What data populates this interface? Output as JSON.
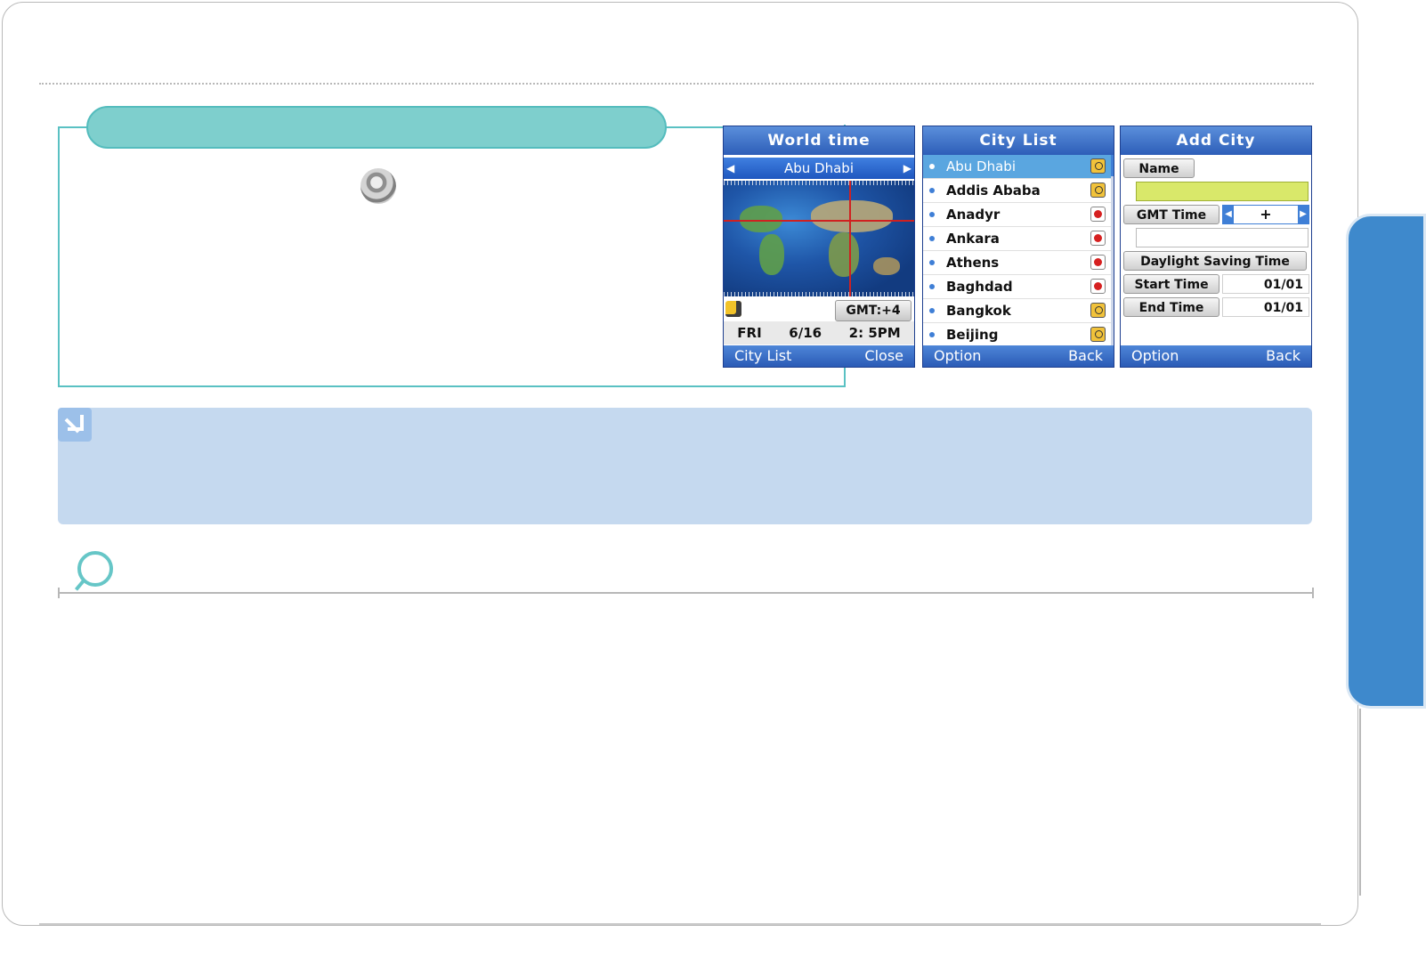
{
  "world_time": {
    "title": "World time",
    "city": "Abu Dhabi",
    "gmt": "GMT:+4",
    "day": "FRI",
    "date": "6/16",
    "time": "2: 5PM",
    "left_softkey": "City List",
    "right_softkey": "Close"
  },
  "city_list": {
    "title": "City List",
    "items": [
      {
        "name": "Abu Dhabi",
        "status_icon": "clock-icon"
      },
      {
        "name": "Addis Ababa",
        "status_icon": "clock-icon"
      },
      {
        "name": "Anadyr",
        "status_icon": "alarm-icon"
      },
      {
        "name": "Ankara",
        "status_icon": "alarm-icon"
      },
      {
        "name": "Athens",
        "status_icon": "alarm-icon"
      },
      {
        "name": "Baghdad",
        "status_icon": "alarm-icon"
      },
      {
        "name": "Bangkok",
        "status_icon": "clock-icon"
      },
      {
        "name": "Beijing",
        "status_icon": "clock-icon"
      }
    ],
    "left_softkey": "Option",
    "right_softkey": "Back"
  },
  "add_city": {
    "title": "Add City",
    "name_label": "Name",
    "name_value": "",
    "gmt_label": "GMT Time",
    "gmt_sign": "+",
    "gmt_value": "",
    "dst_label": "Daylight Saving Time",
    "start_label": "Start Time",
    "start_value": "01/01",
    "end_label": "End Time",
    "end_value": "01/01",
    "left_softkey": "Option",
    "right_softkey": "Back"
  },
  "colors": {
    "accent_teal": "#7ecfcd",
    "note_blue": "#c5d9ef",
    "side_tab": "#3e89cc",
    "screen_header": "#2d5eb8"
  }
}
